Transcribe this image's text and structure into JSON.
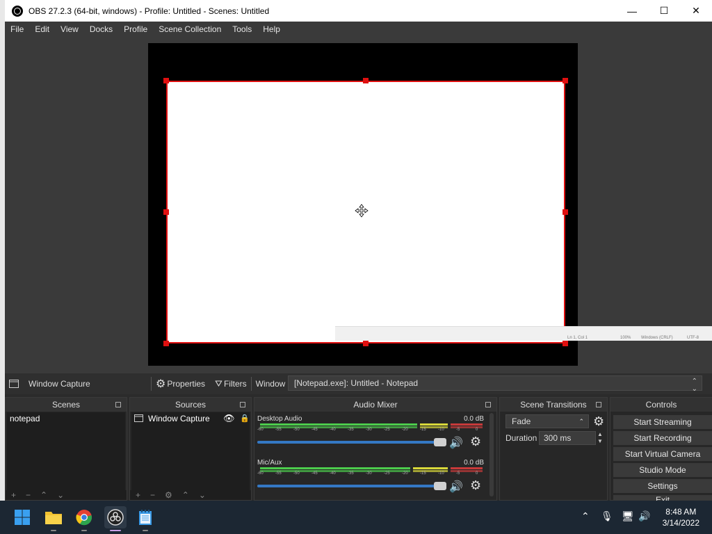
{
  "window": {
    "title": "OBS 27.2.3 (64-bit, windows) - Profile: Untitled - Scenes: Untitled",
    "minimize": "—",
    "maximize": "☐",
    "close": "✕"
  },
  "menu": [
    "File",
    "Edit",
    "View",
    "Docks",
    "Profile",
    "Scene Collection",
    "Tools",
    "Help"
  ],
  "preview": {
    "notepad_status": [
      "Ln 1, Col 1",
      "100%",
      "Windows (CRLF)",
      "UTF-8"
    ]
  },
  "source_toolbar": {
    "source_name": "Window Capture",
    "properties": "Properties",
    "filters": "Filters",
    "window_label": "Window",
    "window_value": "[Notepad.exe]: Untitled - Notepad"
  },
  "docks": {
    "scenes": {
      "title": "Scenes",
      "items": [
        "notepad"
      ]
    },
    "sources": {
      "title": "Sources",
      "items": [
        "Window Capture"
      ]
    },
    "mixer": {
      "title": "Audio Mixer",
      "tracks": [
        {
          "name": "Desktop Audio",
          "db": "0.0 dB"
        },
        {
          "name": "Mic/Aux",
          "db": "0.0 dB"
        }
      ],
      "ticks": [
        "-60",
        "-55",
        "-50",
        "-45",
        "-40",
        "-35",
        "-30",
        "-25",
        "-20",
        "-15",
        "-10",
        "-5",
        "0"
      ]
    },
    "transitions": {
      "title": "Scene Transitions",
      "selected": "Fade",
      "duration_label": "Duration",
      "duration_value": "300 ms"
    },
    "controls": {
      "title": "Controls",
      "buttons": [
        "Start Streaming",
        "Start Recording",
        "Start Virtual Camera",
        "Studio Mode",
        "Settings",
        "Exit"
      ]
    }
  },
  "taskbar": {
    "time": "8:48 AM",
    "date": "3/14/2022"
  },
  "colors": {
    "selection_red": "#e01010",
    "meter_green": "#4ccc4c",
    "meter_yellow": "#d8d83a",
    "meter_red": "#c83a3a",
    "slider_blue": "#3478c4"
  }
}
